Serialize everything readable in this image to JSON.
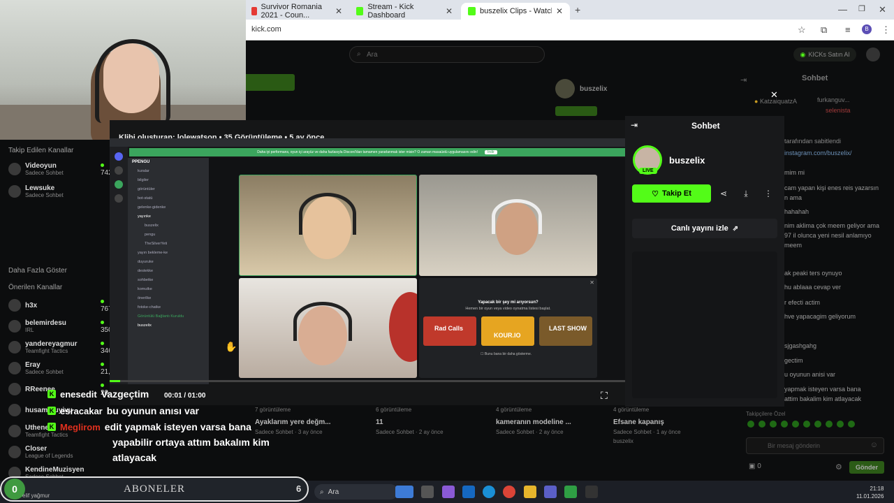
{
  "browser": {
    "tabs": [
      {
        "title": "Survivor Romania 2021 - Coun...",
        "color": "#e53935"
      },
      {
        "title": "Stream - Kick Dashboard",
        "color": "#53fc18"
      },
      {
        "title": "buszelix Clips - Watch Live on K...",
        "color": "#53fc18"
      }
    ],
    "new_tab": "+",
    "address": "kick.com"
  },
  "kick_bg": {
    "search_placeholder": "Ara",
    "kicks_button": "KICKs Satın Al",
    "chat_title": "Sohbet",
    "followed_heading": "Takip Edilen Kanallar",
    "followed": [
      {
        "name": "Videoyun",
        "sub": "Sadece Sohbet",
        "count": "742"
      },
      {
        "name": "Lewsuke",
        "sub": "Sadece Sohbet",
        "count": ""
      }
    ],
    "more": "Daha Fazla Göster",
    "recommended_heading": "Önerilen Kanallar",
    "recommended": [
      {
        "name": "h3x",
        "sub": "",
        "count": "767"
      },
      {
        "name": "belemirdesu",
        "sub": "IRL",
        "count": "350"
      },
      {
        "name": "yandereyagmur",
        "sub": "Teamfight Tactics",
        "count": "346"
      },
      {
        "name": "Eray",
        "sub": "Sadece Sohbet",
        "count": "21,8"
      },
      {
        "name": "RReenee",
        "sub": "",
        "count": "20,4"
      },
      {
        "name": "husamvruyivu",
        "sub": "",
        "count": ""
      },
      {
        "name": "Uthenera",
        "sub": "Teamfight Tactics",
        "count": ""
      },
      {
        "name": "Closer",
        "sub": "League of Legends",
        "count": ""
      },
      {
        "name": "KendineMuzisyen",
        "sub": "Sadece Sohbet",
        "count": ""
      }
    ],
    "cards": [
      {
        "views": "7 görüntüleme",
        "title": "Ayaklarım yere değm...",
        "sub": "Sadece Sohbet · 3 ay önce"
      },
      {
        "views": "6 görüntüleme",
        "title": "11",
        "sub": "Sadece Sohbet · 2 ay önce"
      },
      {
        "views": "4 görüntüleme",
        "title": "kameranın modeline ...",
        "sub": "Sadece Sohbet · 2 ay önce"
      },
      {
        "views": "4 görüntüleme",
        "title": "Efsane kapanış",
        "sub": "Sadece Sohbet · 1 ay önce",
        "channel": "buszelix"
      }
    ],
    "right_chat": [
      "tarafından sabitlendi",
      "instagram.com/buszelix/",
      "mim mi",
      "cam yapan kişi enes reis yazarsın",
      "n ama",
      "hahahah",
      "nim aklima çok meem geliyor ama",
      "97 il olunca yeni nesil anlamıyo",
      "meem",
      "ak peaki ters oynuyo",
      "hu ablaaa cevap ver",
      "r efecti actim",
      "hve yapacagim geliyorum",
      "sjgashgahg",
      "gectim",
      "u oyunun anisi var",
      "yapmak isteyen varsa bana",
      "attim bakalim kim atlayacak"
    ],
    "top_viewers": [
      "KatzaiquatzA",
      "furkanguv...",
      "selenista"
    ],
    "chat_input": "Bir mesaj gönderin",
    "send": "Gönder",
    "kicks": "0",
    "pinned": "Takipçilere Özel"
  },
  "player": {
    "title": "Klibi oluşturan: lolewatson • 35 Görüntüleme • 5 ay önce",
    "time": "00:01 / 01:00",
    "progress": 0.02
  },
  "discord": {
    "server": "PPENGU",
    "banner": "Daha iyi performans, oyun içi arayüz ve daha fazlasıyla Discord'dan tamamen yararlanmak ister misin? O zaman masaüstü uygulamasını edin!",
    "banner_btn": "İndir",
    "channels": [
      "kuralar",
      "bilgiler",
      "görüntüler",
      "bot-statü",
      "gelenke-gidenke",
      "yayınke",
      "buszelix",
      "pengu",
      "TheSilverYeti",
      "yayın bekleme-ke",
      "duyuruke",
      "destekke",
      "sohbetke",
      "komutke",
      "önerilke",
      "fotoke-chatke"
    ],
    "voice_status": "Görüntülü Bağlantı Kuruldu",
    "user": "buszelix",
    "activity_title": "Yapacak bir şey mi arıyorsun?",
    "activity_sub": "Hemen bir oyun veya video oynatma listesi başlat.",
    "games": [
      "Rad Calls",
      "KOUR.IO",
      "LAST SHOW"
    ],
    "dont_show": "Bunu bana bir daha gösterme."
  },
  "chat_panel": {
    "title": "Sohbet",
    "channel": "buszelix",
    "live_badge": "LIVE",
    "follow": "Takip Et",
    "watch_live": "Canlı yayını izle"
  },
  "overlay_chat": [
    {
      "name": "enesedit",
      "name_color": "#ffffff",
      "msg": "Vazgeçtim"
    },
    {
      "name": "esracakar",
      "name_color": "#ffffff",
      "msg": "bu oyunun anısı var"
    },
    {
      "name": "Meglirom",
      "name_color": "#e0301e",
      "msg": "edit yapmak isteyen varsa bana"
    },
    {
      "name": "",
      "name_color": "#ffffff",
      "msg": "yapabilir ortaya attım bakalım kim"
    },
    {
      "name": "",
      "name_color": "#ffffff",
      "msg": "atlayacak"
    }
  ],
  "aboneler": {
    "label": "ABONELER",
    "count": "0",
    "max": "6",
    "last": "elif yağmur"
  },
  "taskbar": {
    "search": "Ara",
    "time": "21:18",
    "date": "11.01.2026"
  }
}
